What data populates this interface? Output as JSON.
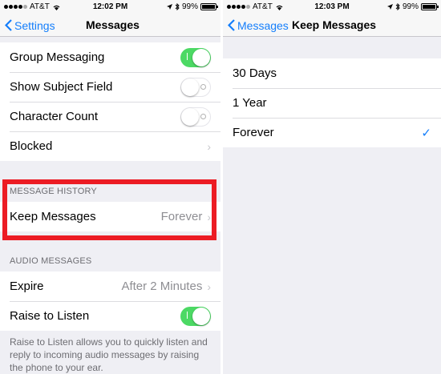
{
  "left": {
    "status": {
      "carrier": "AT&T",
      "time": "12:02 PM",
      "battery": "99%",
      "battery_level": 0.99
    },
    "nav": {
      "back_label": "Settings",
      "title": "Messages"
    },
    "top_group": [
      {
        "label": "Group Messaging",
        "control": "toggle",
        "on": true
      },
      {
        "label": "Show Subject Field",
        "control": "toggle",
        "on": false
      },
      {
        "label": "Character Count",
        "control": "toggle",
        "on": false
      },
      {
        "label": "Blocked",
        "control": "chevron"
      }
    ],
    "history": {
      "header": "MESSAGE HISTORY",
      "keep_label": "Keep Messages",
      "keep_value": "Forever"
    },
    "audio": {
      "header": "AUDIO MESSAGES",
      "expire_label": "Expire",
      "expire_value": "After 2 Minutes",
      "raise_label": "Raise to Listen",
      "raise_on": true,
      "footer": "Raise to Listen allows you to quickly listen and reply to incoming audio messages by raising the phone to your ear."
    }
  },
  "right": {
    "status": {
      "carrier": "AT&T",
      "time": "12:03 PM",
      "battery": "99%",
      "battery_level": 0.99
    },
    "nav": {
      "back_label": "Messages",
      "title": "Keep Messages"
    },
    "options": [
      {
        "label": "30 Days",
        "selected": false
      },
      {
        "label": "1 Year",
        "selected": false
      },
      {
        "label": "Forever",
        "selected": true
      }
    ],
    "check_glyph": "✓"
  },
  "colors": {
    "accent": "#147efb",
    "toggle_on": "#4cd964",
    "highlight": "#ec1c24"
  },
  "icons": [
    "wifi-icon",
    "location-icon",
    "bluetooth-icon",
    "battery-icon",
    "back-chevron-icon",
    "chevron-right-icon",
    "checkmark-icon"
  ]
}
